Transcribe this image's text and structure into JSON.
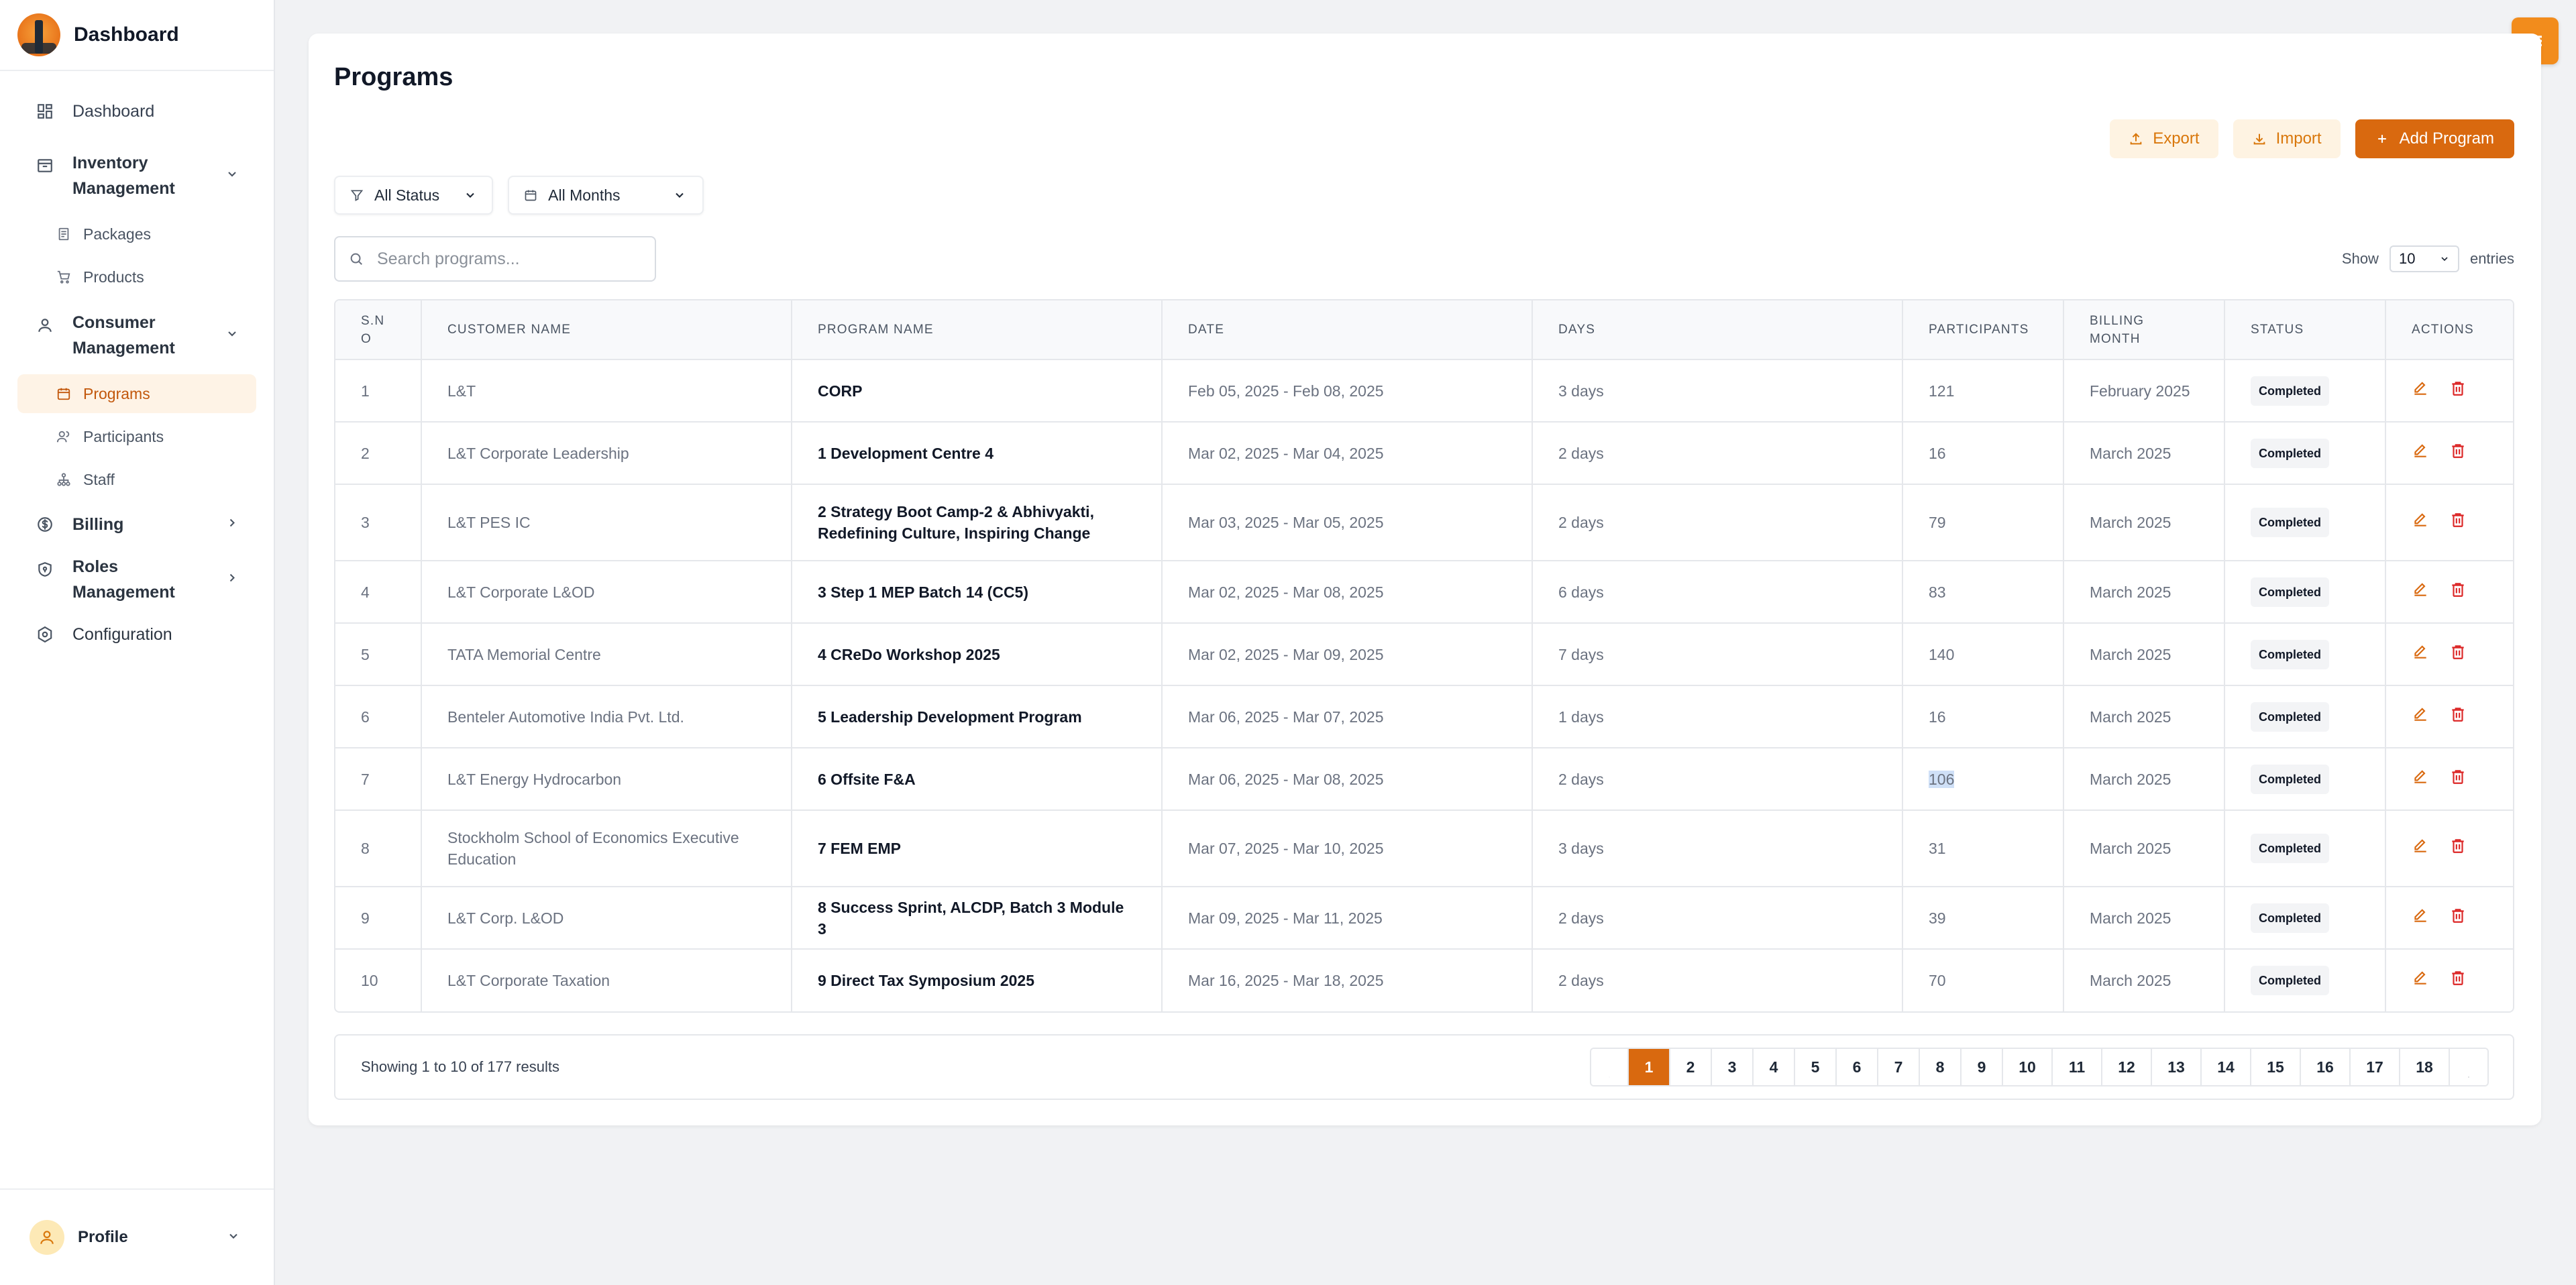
{
  "brand": {
    "title": "Dashboard"
  },
  "sidebar": {
    "items": [
      {
        "label": "Dashboard",
        "icon": "grid-icon"
      },
      {
        "label": "Inventory Management",
        "icon": "archive-icon",
        "expanded": true,
        "children": [
          {
            "label": "Packages",
            "icon": "document-icon"
          },
          {
            "label": "Products",
            "icon": "cart-icon"
          }
        ]
      },
      {
        "label": "Consumer Management",
        "icon": "user-icon",
        "expanded": true,
        "children": [
          {
            "label": "Programs",
            "icon": "calendar-icon",
            "active": true
          },
          {
            "label": "Participants",
            "icon": "users-icon"
          },
          {
            "label": "Staff",
            "icon": "sitemap-icon"
          }
        ]
      },
      {
        "label": "Billing",
        "icon": "dollar-circle-icon",
        "expanded": false
      },
      {
        "label": "Roles Management",
        "icon": "shield-icon",
        "expanded": false
      },
      {
        "label": "Configuration",
        "icon": "settings-hexagon-icon"
      }
    ],
    "inventory_l1": "Inventory",
    "inventory_l2": "Management",
    "consumer_l1": "Consumer",
    "consumer_l2": "Management",
    "roles_l1": "Roles",
    "roles_l2": "Management"
  },
  "profile": {
    "label": "Profile"
  },
  "page": {
    "title": "Programs"
  },
  "toolbar": {
    "export_label": "Export",
    "import_label": "Import",
    "add_label": "Add Program"
  },
  "filters": {
    "status_label": "All Status",
    "months_label": "All Months"
  },
  "search": {
    "placeholder": "Search programs..."
  },
  "entries": {
    "show_label": "Show",
    "value": "10",
    "suffix": "entries"
  },
  "table": {
    "headers": [
      "S.N O",
      "CUSTOMER NAME",
      "PROGRAM NAME",
      "DATE",
      "DAYS",
      "PARTICIPANTS",
      "BILLING MONTH",
      "STATUS",
      "ACTIONS"
    ],
    "rows": [
      {
        "sno": "1",
        "customer": "L&T",
        "program": "CORP",
        "date": "Feb 05, 2025 - Feb 08, 2025",
        "days": "3 days",
        "participants": "121",
        "billing": "February 2025",
        "status": "Completed"
      },
      {
        "sno": "2",
        "customer": "L&T Corporate Leadership",
        "program": "1 Development Centre 4",
        "date": "Mar 02, 2025 - Mar 04, 2025",
        "days": "2 days",
        "participants": "16",
        "billing": "March 2025",
        "status": "Completed"
      },
      {
        "sno": "3",
        "customer": "L&T PES IC",
        "program": "2 Strategy Boot Camp-2 & Abhivyakti, Redefining Culture, Inspiring Change",
        "date": "Mar 03, 2025 - Mar 05, 2025",
        "days": "2 days",
        "participants": "79",
        "billing": "March 2025",
        "status": "Completed"
      },
      {
        "sno": "4",
        "customer": "L&T Corporate L&OD",
        "program": "3 Step 1 MEP Batch 14 (CC5)",
        "date": "Mar 02, 2025 - Mar 08, 2025",
        "days": "6 days",
        "participants": "83",
        "billing": "March 2025",
        "status": "Completed"
      },
      {
        "sno": "5",
        "customer": "TATA Memorial Centre",
        "program": "4 CReDo Workshop 2025",
        "date": "Mar 02, 2025 - Mar 09, 2025",
        "days": "7 days",
        "participants": "140",
        "billing": "March 2025",
        "status": "Completed"
      },
      {
        "sno": "6",
        "customer": "Benteler Automotive India Pvt. Ltd.",
        "program": "5 Leadership Development Program",
        "date": "Mar 06, 2025 - Mar 07, 2025",
        "days": "1 days",
        "participants": "16",
        "billing": "March 2025",
        "status": "Completed"
      },
      {
        "sno": "7",
        "customer": "L&T Energy Hydrocarbon",
        "program": "6 Offsite F&A",
        "date": "Mar 06, 2025 - Mar 08, 2025",
        "days": "2 days",
        "participants": "106",
        "billing": "March 2025",
        "status": "Completed"
      },
      {
        "sno": "8",
        "customer": "Stockholm School of Economics Executive Education",
        "program": "7 FEM EMP",
        "date": "Mar 07, 2025 - Mar 10, 2025",
        "days": "3 days",
        "participants": "31",
        "billing": "March 2025",
        "status": "Completed"
      },
      {
        "sno": "9",
        "customer": "L&T Corp. L&OD",
        "program": "8 Success Sprint, ALCDP, Batch 3 Module 3",
        "date": "Mar 09, 2025 - Mar 11, 2025",
        "days": "2 days",
        "participants": "39",
        "billing": "March 2025",
        "status": "Completed"
      },
      {
        "sno": "10",
        "customer": "L&T Corporate Taxation",
        "program": "9 Direct Tax Symposium 2025",
        "date": "Mar 16, 2025 - Mar 18, 2025",
        "days": "2 days",
        "participants": "70",
        "billing": "March 2025",
        "status": "Completed"
      }
    ]
  },
  "pagination": {
    "summary": "Showing 1 to 10 of 177 results",
    "pages": [
      "1",
      "2",
      "3",
      "4",
      "5",
      "6",
      "7",
      "8",
      "9",
      "10",
      "11",
      "12",
      "13",
      "14",
      "15",
      "16",
      "17",
      "18"
    ],
    "current": "1"
  },
  "colors": {
    "accent": "#d9690f",
    "accent_soft": "#fef3e2",
    "danger": "#dc2626"
  }
}
